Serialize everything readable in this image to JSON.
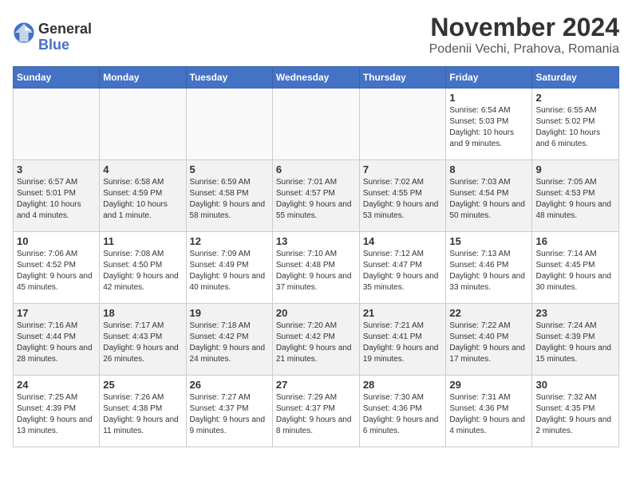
{
  "logo": {
    "line1": "General",
    "line2": "Blue"
  },
  "title": "November 2024",
  "subtitle": "Podenii Vechi, Prahova, Romania",
  "days_of_week": [
    "Sunday",
    "Monday",
    "Tuesday",
    "Wednesday",
    "Thursday",
    "Friday",
    "Saturday"
  ],
  "weeks": [
    [
      {
        "day": "",
        "info": ""
      },
      {
        "day": "",
        "info": ""
      },
      {
        "day": "",
        "info": ""
      },
      {
        "day": "",
        "info": ""
      },
      {
        "day": "",
        "info": ""
      },
      {
        "day": "1",
        "info": "Sunrise: 6:54 AM\nSunset: 5:03 PM\nDaylight: 10 hours and 9 minutes."
      },
      {
        "day": "2",
        "info": "Sunrise: 6:55 AM\nSunset: 5:02 PM\nDaylight: 10 hours and 6 minutes."
      }
    ],
    [
      {
        "day": "3",
        "info": "Sunrise: 6:57 AM\nSunset: 5:01 PM\nDaylight: 10 hours and 4 minutes."
      },
      {
        "day": "4",
        "info": "Sunrise: 6:58 AM\nSunset: 4:59 PM\nDaylight: 10 hours and 1 minute."
      },
      {
        "day": "5",
        "info": "Sunrise: 6:59 AM\nSunset: 4:58 PM\nDaylight: 9 hours and 58 minutes."
      },
      {
        "day": "6",
        "info": "Sunrise: 7:01 AM\nSunset: 4:57 PM\nDaylight: 9 hours and 55 minutes."
      },
      {
        "day": "7",
        "info": "Sunrise: 7:02 AM\nSunset: 4:55 PM\nDaylight: 9 hours and 53 minutes."
      },
      {
        "day": "8",
        "info": "Sunrise: 7:03 AM\nSunset: 4:54 PM\nDaylight: 9 hours and 50 minutes."
      },
      {
        "day": "9",
        "info": "Sunrise: 7:05 AM\nSunset: 4:53 PM\nDaylight: 9 hours and 48 minutes."
      }
    ],
    [
      {
        "day": "10",
        "info": "Sunrise: 7:06 AM\nSunset: 4:52 PM\nDaylight: 9 hours and 45 minutes."
      },
      {
        "day": "11",
        "info": "Sunrise: 7:08 AM\nSunset: 4:50 PM\nDaylight: 9 hours and 42 minutes."
      },
      {
        "day": "12",
        "info": "Sunrise: 7:09 AM\nSunset: 4:49 PM\nDaylight: 9 hours and 40 minutes."
      },
      {
        "day": "13",
        "info": "Sunrise: 7:10 AM\nSunset: 4:48 PM\nDaylight: 9 hours and 37 minutes."
      },
      {
        "day": "14",
        "info": "Sunrise: 7:12 AM\nSunset: 4:47 PM\nDaylight: 9 hours and 35 minutes."
      },
      {
        "day": "15",
        "info": "Sunrise: 7:13 AM\nSunset: 4:46 PM\nDaylight: 9 hours and 33 minutes."
      },
      {
        "day": "16",
        "info": "Sunrise: 7:14 AM\nSunset: 4:45 PM\nDaylight: 9 hours and 30 minutes."
      }
    ],
    [
      {
        "day": "17",
        "info": "Sunrise: 7:16 AM\nSunset: 4:44 PM\nDaylight: 9 hours and 28 minutes."
      },
      {
        "day": "18",
        "info": "Sunrise: 7:17 AM\nSunset: 4:43 PM\nDaylight: 9 hours and 26 minutes."
      },
      {
        "day": "19",
        "info": "Sunrise: 7:18 AM\nSunset: 4:42 PM\nDaylight: 9 hours and 24 minutes."
      },
      {
        "day": "20",
        "info": "Sunrise: 7:20 AM\nSunset: 4:42 PM\nDaylight: 9 hours and 21 minutes."
      },
      {
        "day": "21",
        "info": "Sunrise: 7:21 AM\nSunset: 4:41 PM\nDaylight: 9 hours and 19 minutes."
      },
      {
        "day": "22",
        "info": "Sunrise: 7:22 AM\nSunset: 4:40 PM\nDaylight: 9 hours and 17 minutes."
      },
      {
        "day": "23",
        "info": "Sunrise: 7:24 AM\nSunset: 4:39 PM\nDaylight: 9 hours and 15 minutes."
      }
    ],
    [
      {
        "day": "24",
        "info": "Sunrise: 7:25 AM\nSunset: 4:39 PM\nDaylight: 9 hours and 13 minutes."
      },
      {
        "day": "25",
        "info": "Sunrise: 7:26 AM\nSunset: 4:38 PM\nDaylight: 9 hours and 11 minutes."
      },
      {
        "day": "26",
        "info": "Sunrise: 7:27 AM\nSunset: 4:37 PM\nDaylight: 9 hours and 9 minutes."
      },
      {
        "day": "27",
        "info": "Sunrise: 7:29 AM\nSunset: 4:37 PM\nDaylight: 9 hours and 8 minutes."
      },
      {
        "day": "28",
        "info": "Sunrise: 7:30 AM\nSunset: 4:36 PM\nDaylight: 9 hours and 6 minutes."
      },
      {
        "day": "29",
        "info": "Sunrise: 7:31 AM\nSunset: 4:36 PM\nDaylight: 9 hours and 4 minutes."
      },
      {
        "day": "30",
        "info": "Sunrise: 7:32 AM\nSunset: 4:35 PM\nDaylight: 9 hours and 2 minutes."
      }
    ]
  ]
}
